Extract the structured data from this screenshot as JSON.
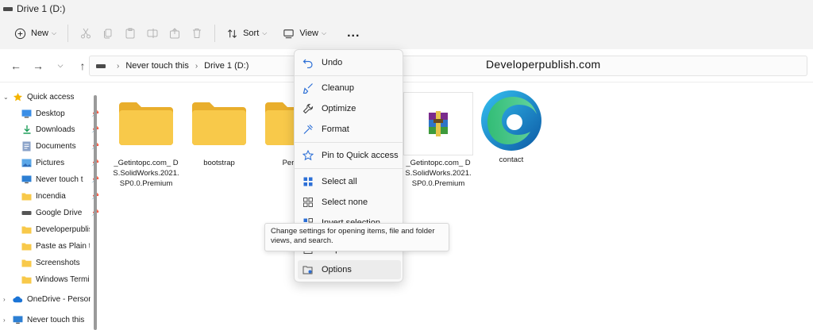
{
  "window": {
    "title": "Drive 1 (D:)"
  },
  "toolbar": {
    "new_label": "New",
    "sort_label": "Sort",
    "view_label": "View",
    "more_label": "..."
  },
  "address": {
    "crumbs": [
      "Never touch this",
      "Drive 1 (D:)"
    ]
  },
  "watermark": "Developerpublish.com",
  "sidebar": {
    "items": [
      {
        "label": "Quick access",
        "icon": "star-icon",
        "pinned": false
      },
      {
        "label": "Desktop",
        "icon": "desktop-icon",
        "pinned": true
      },
      {
        "label": "Downloads",
        "icon": "download-icon",
        "pinned": true
      },
      {
        "label": "Documents",
        "icon": "documents-icon",
        "pinned": true
      },
      {
        "label": "Pictures",
        "icon": "pictures-icon",
        "pinned": true
      },
      {
        "label": "Never touch t",
        "icon": "monitor-icon",
        "pinned": true
      },
      {
        "label": "Incendia",
        "icon": "folder-icon",
        "pinned": true
      },
      {
        "label": "Google Drive",
        "icon": "drive-icon",
        "pinned": true
      },
      {
        "label": "Developerpublis",
        "icon": "folder-icon",
        "pinned": false
      },
      {
        "label": "Paste as Plain te",
        "icon": "folder-icon",
        "pinned": false
      },
      {
        "label": "Screenshots",
        "icon": "folder-icon",
        "pinned": false
      },
      {
        "label": "Windows Termin",
        "icon": "folder-icon",
        "pinned": false
      },
      {
        "label": "OneDrive - Person",
        "icon": "cloud-icon",
        "pinned": false
      },
      {
        "label": "Never touch this",
        "icon": "monitor-icon",
        "pinned": false
      }
    ]
  },
  "files": [
    {
      "name": "_Getintopc.com_ DS.SolidWorks.2021.SP0.0.Premium",
      "icon": "folder-icon"
    },
    {
      "name": "bootstrap",
      "icon": "folder-icon"
    },
    {
      "name": "Perso",
      "icon": "folder-icon"
    },
    {
      "name": "_Getintopc.com_ DS.SolidWorks.2021.SP0.0.Premium",
      "icon": "winrar-archive-icon"
    },
    {
      "name": "contact",
      "icon": "edge-icon"
    }
  ],
  "menu": {
    "items": [
      {
        "label": "Undo",
        "icon": "undo-icon"
      },
      {
        "label": "Cleanup",
        "icon": "broom-icon"
      },
      {
        "label": "Optimize",
        "icon": "wrench-icon"
      },
      {
        "label": "Format",
        "icon": "format-icon"
      },
      {
        "label": "Pin to Quick access",
        "icon": "star-outline-icon"
      },
      {
        "label": "Select all",
        "icon": "select-all-icon"
      },
      {
        "label": "Select none",
        "icon": "select-none-icon"
      },
      {
        "label": "Invert selection",
        "icon": "invert-selection-icon"
      },
      {
        "label": "Properties",
        "icon": "properties-icon"
      },
      {
        "label": "Options",
        "icon": "options-icon"
      }
    ]
  },
  "tooltip": {
    "text": "Change settings for opening items, file and folder views, and search."
  },
  "colors": {
    "folder": "#F8C94A",
    "accent": "#2C6FD6",
    "quickaccess_star": "#F4B400"
  }
}
